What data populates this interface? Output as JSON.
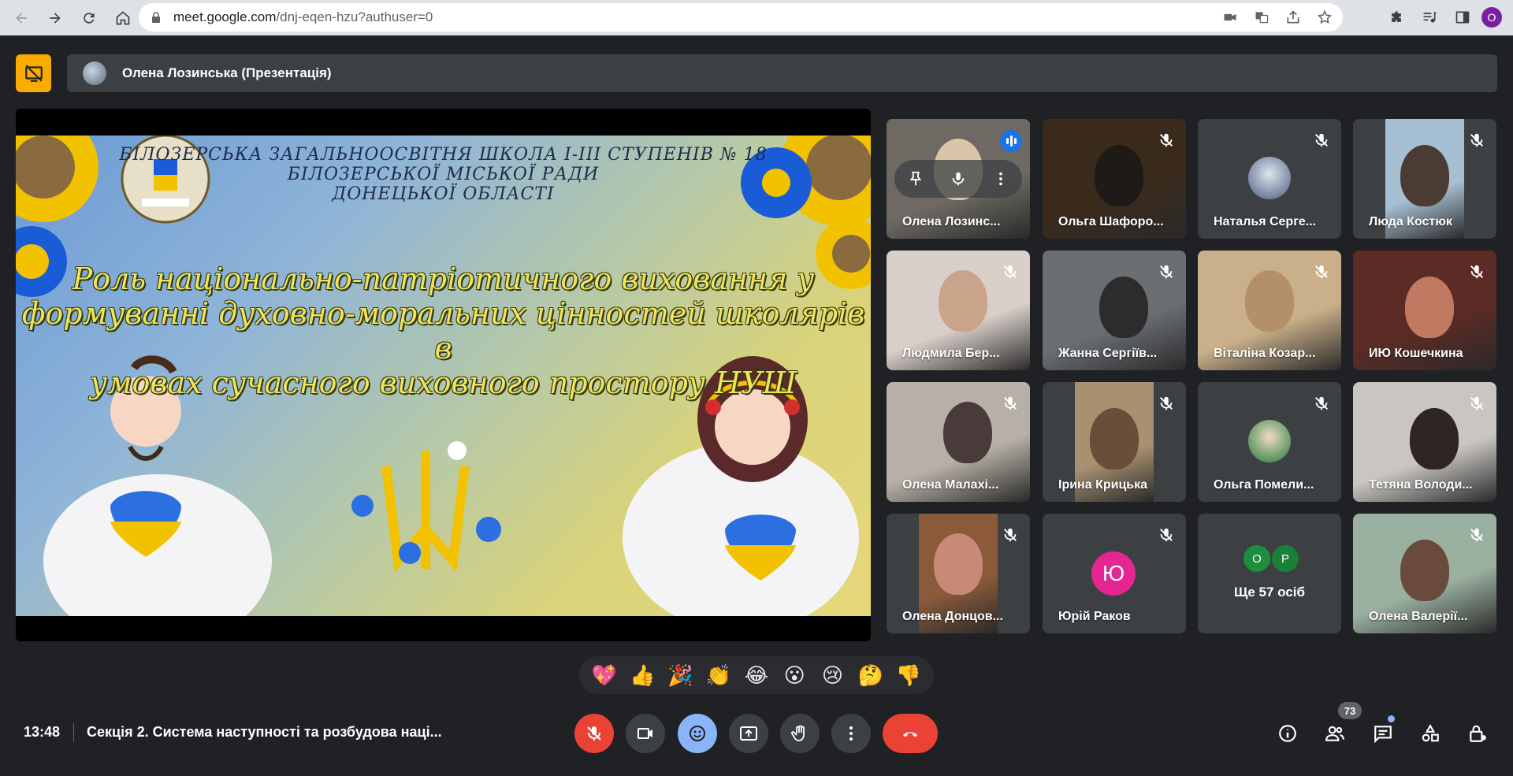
{
  "browser": {
    "url_host": "meet.google.com",
    "url_path": "/dnj-eqen-hzu?authuser=0",
    "profile_initial": "O"
  },
  "presenter": {
    "label": "Олена Лозинська (Презентація)"
  },
  "slide": {
    "school_line1": "БІЛОЗЕРСЬКА ЗАГАЛЬНООСВІТНЯ ШКОЛА І-ІІІ СТУПЕНІВ № 18",
    "school_line2": "БІЛОЗЕРСЬКОЇ МІСЬКОЇ РАДИ",
    "school_line3": "ДОНЕЦЬКОЇ ОБЛАСТІ",
    "title_line1": "Роль національно-патріотичного виховання у",
    "title_line2": "формуванні духовно-моральних цінностей школярів в",
    "title_line3": "умовах сучасного виховного простору НУШ"
  },
  "participants": [
    {
      "name": "Олена Лозинс...",
      "state": "speaking"
    },
    {
      "name": "Ольга Шафоро...",
      "state": "muted"
    },
    {
      "name": "Наталья Серге...",
      "state": "muted"
    },
    {
      "name": "Люда Костюк",
      "state": "muted"
    },
    {
      "name": "Людмила Бер...",
      "state": "muted"
    },
    {
      "name": "Жанна Сергіїв...",
      "state": "muted"
    },
    {
      "name": "Віталіна Козар...",
      "state": "muted"
    },
    {
      "name": "ИЮ Кошечкина",
      "state": "muted"
    },
    {
      "name": "Олена Малахі...",
      "state": "muted"
    },
    {
      "name": "Ірина Крицька",
      "state": "muted"
    },
    {
      "name": "Ольга Помели...",
      "state": "muted"
    },
    {
      "name": "Тетяна Володи...",
      "state": "muted"
    },
    {
      "name": "Олена Донцов...",
      "state": "muted"
    },
    {
      "name": "Юрій Раков",
      "state": "muted",
      "initial": "Ю"
    },
    {
      "name": "Ще 57 осіб",
      "state": "more",
      "avatars": [
        "О",
        "Р"
      ]
    },
    {
      "name": "Олена Валерії...",
      "state": "muted"
    }
  ],
  "reactions": [
    "💖",
    "👍",
    "🎉",
    "👏",
    "😂",
    "😮",
    "😢",
    "🤔",
    "👎"
  ],
  "bottom": {
    "time": "13:48",
    "meeting_title": "Секція 2. Система наступності та розбудова наці...",
    "participant_count": "73"
  },
  "colors": {
    "background": "#202124",
    "tile": "#3c4043",
    "hangup": "#ea4335",
    "present_badge": "#f9ab00",
    "accent": "#8ab4f8"
  }
}
